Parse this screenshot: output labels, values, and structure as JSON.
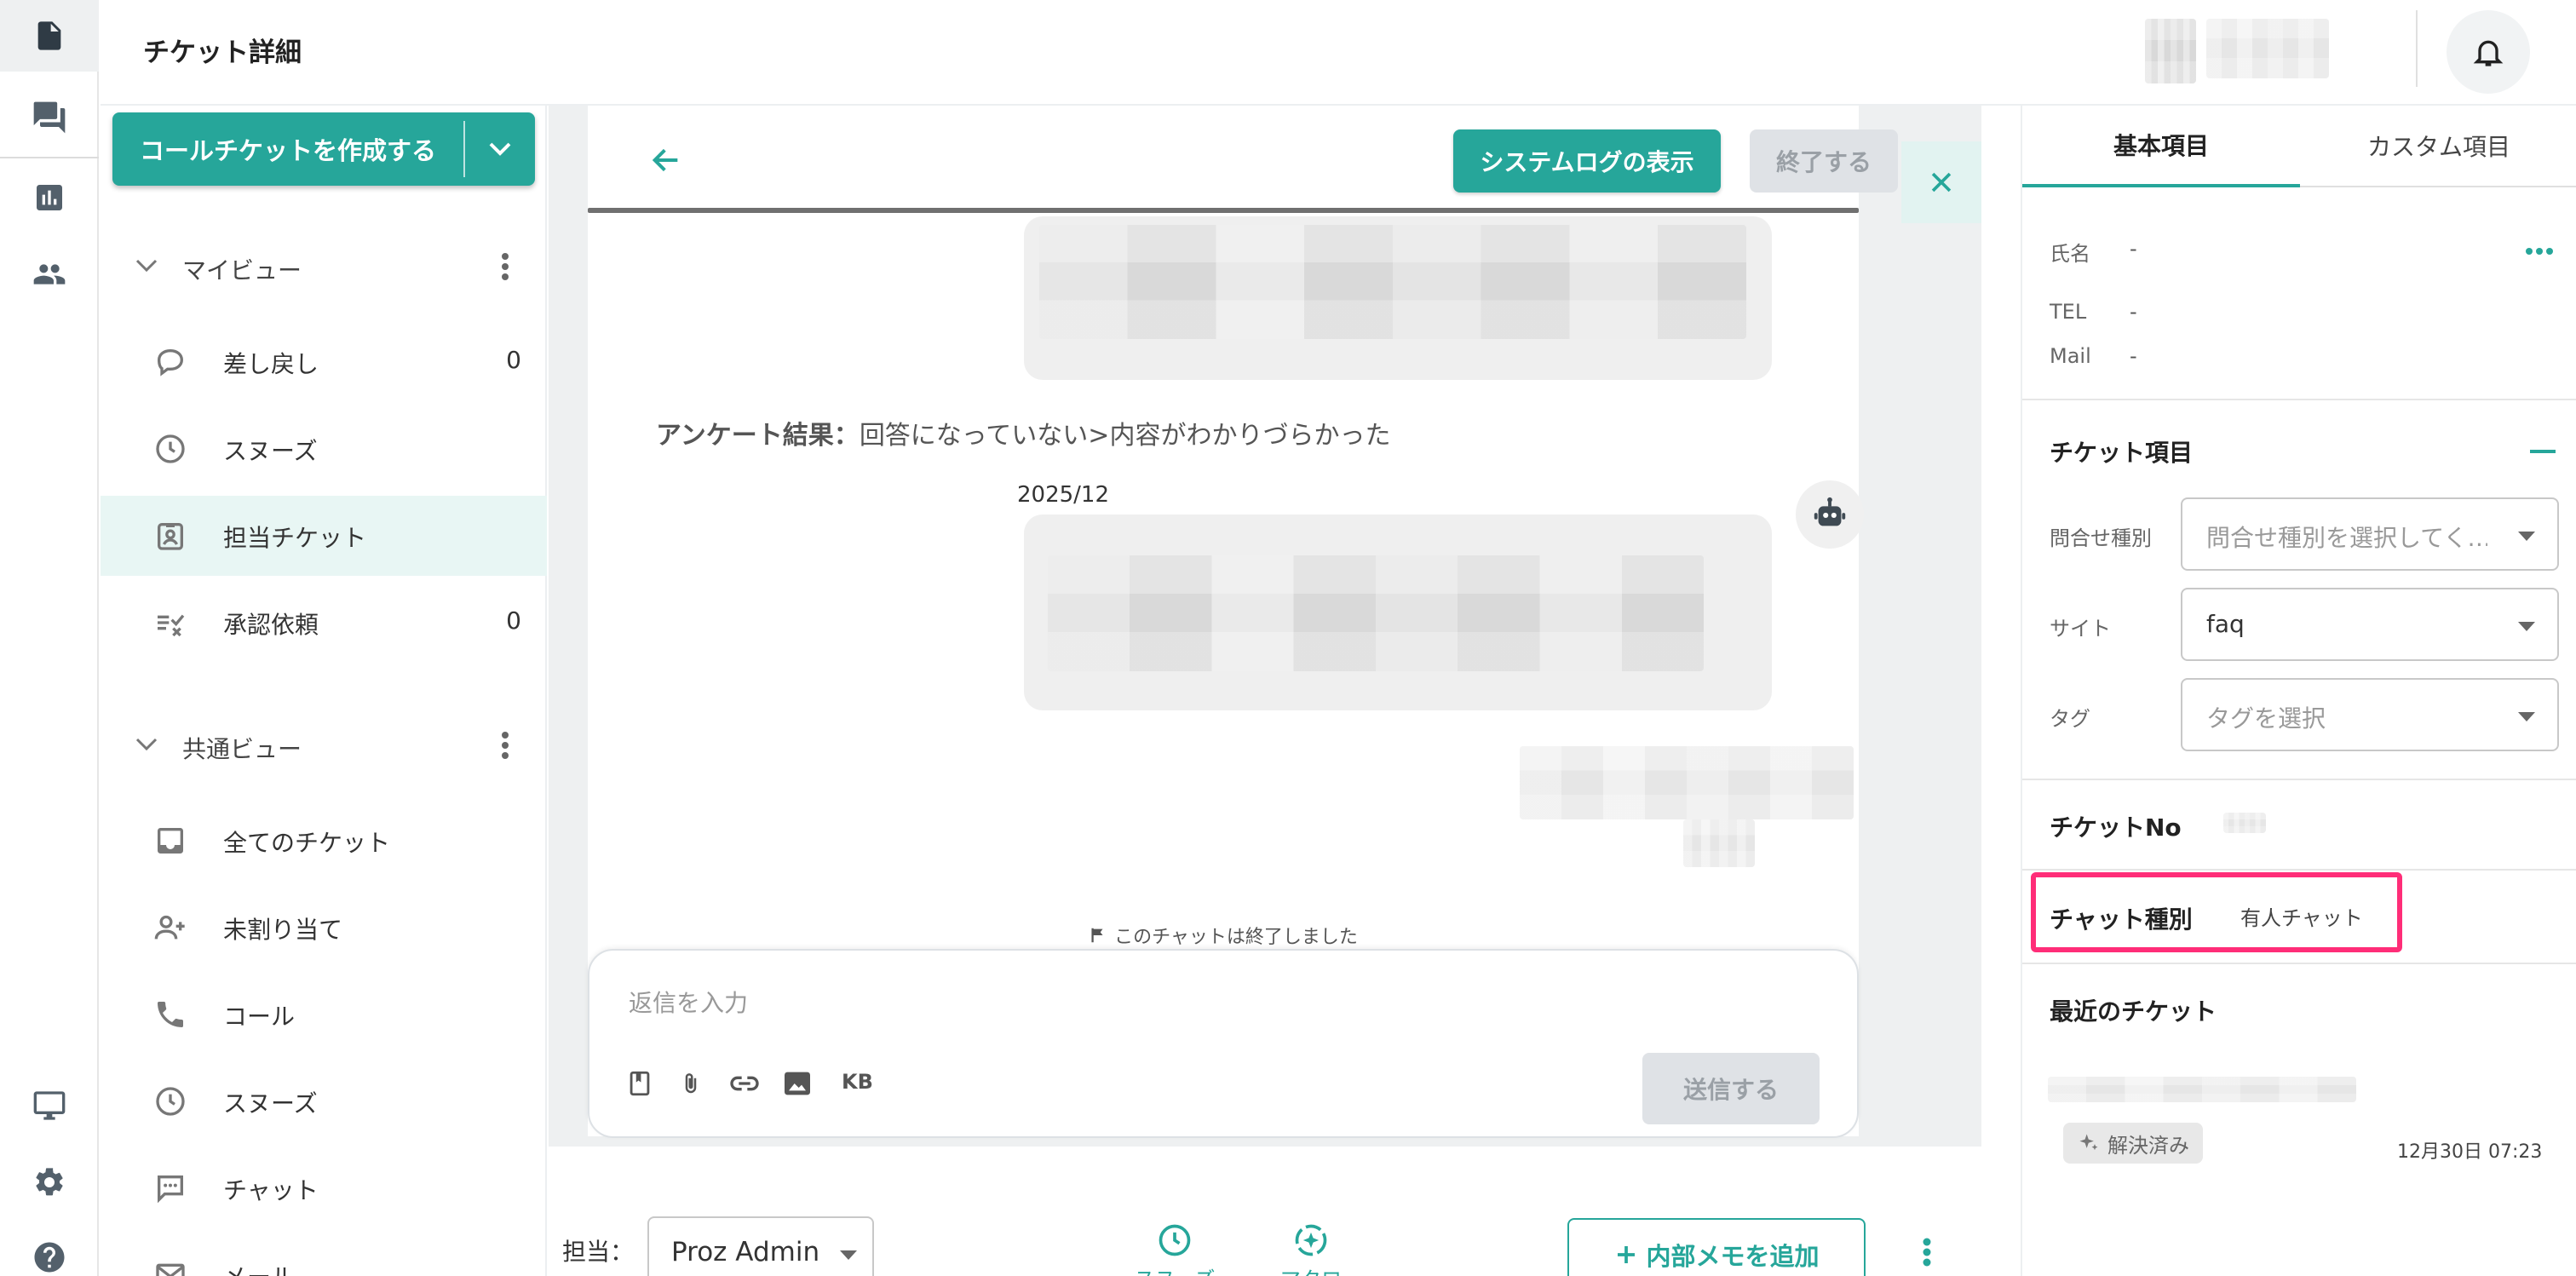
{
  "header": {
    "title": "チケット詳細"
  },
  "rail": {
    "items": [
      {
        "name": "tickets",
        "icon": "document-icon"
      },
      {
        "name": "chats",
        "icon": "chat-bubbles-icon"
      },
      {
        "name": "reports",
        "icon": "bar-chart-icon"
      },
      {
        "name": "users",
        "icon": "people-icon"
      },
      {
        "name": "monitor",
        "icon": "monitor-icon"
      },
      {
        "name": "settings",
        "icon": "gear-icon"
      },
      {
        "name": "help",
        "icon": "help-icon"
      }
    ]
  },
  "left": {
    "create_label": "コールチケットを作成する",
    "my_view": {
      "title": "マイビュー",
      "items": [
        {
          "label": "差し戻し",
          "count": "0"
        },
        {
          "label": "スヌーズ",
          "count": ""
        },
        {
          "label": "担当チケット",
          "count": ""
        },
        {
          "label": "承認依頼",
          "count": "0"
        }
      ]
    },
    "shared_view": {
      "title": "共通ビュー",
      "items": [
        {
          "label": "全てのチケット"
        },
        {
          "label": "未割り当て"
        },
        {
          "label": "コール"
        },
        {
          "label": "スヌーズ"
        },
        {
          "label": "チャット"
        },
        {
          "label": "メール"
        }
      ]
    }
  },
  "chat": {
    "syslog_label": "システムログの表示",
    "end_label": "終了する",
    "survey_prefix": "アンケート結果：",
    "survey_text": "回答になっていない>内容がわかりづらかった",
    "date": "2025/12",
    "ended_note": "このチャットは終了しました",
    "reply_placeholder": "返信を入力",
    "kb_label": "KB",
    "send_label": "送信する"
  },
  "bottom": {
    "assignee_label": "担当：",
    "assignee_value": "Proz Admin",
    "snooze_label": "スヌーズ",
    "macro_label": "マクロ",
    "memo_label": "内部メモを追加"
  },
  "right": {
    "tabs": [
      "基本項目",
      "カスタム項目"
    ],
    "name_label": "氏名",
    "name_value": "-",
    "tel_label": "TEL",
    "tel_value": "-",
    "mail_label": "Mail",
    "mail_value": "-",
    "ticket_items_title": "チケット項目",
    "inquiry_label": "問合せ種別",
    "inquiry_placeholder": "問合せ種別を選択してく…",
    "site_label": "サイト",
    "site_value": "faq",
    "tag_label": "タグ",
    "tag_placeholder": "タグを選択",
    "ticket_no_label": "チケットNo",
    "chat_type_label": "チャット種別",
    "chat_type_value": "有人チャット",
    "recent_title": "最近のチケット",
    "recent_status": "解決済み",
    "recent_time": "12月30日 07:23"
  },
  "colors": {
    "accent": "#26a69a",
    "highlight": "#ff2d78"
  }
}
